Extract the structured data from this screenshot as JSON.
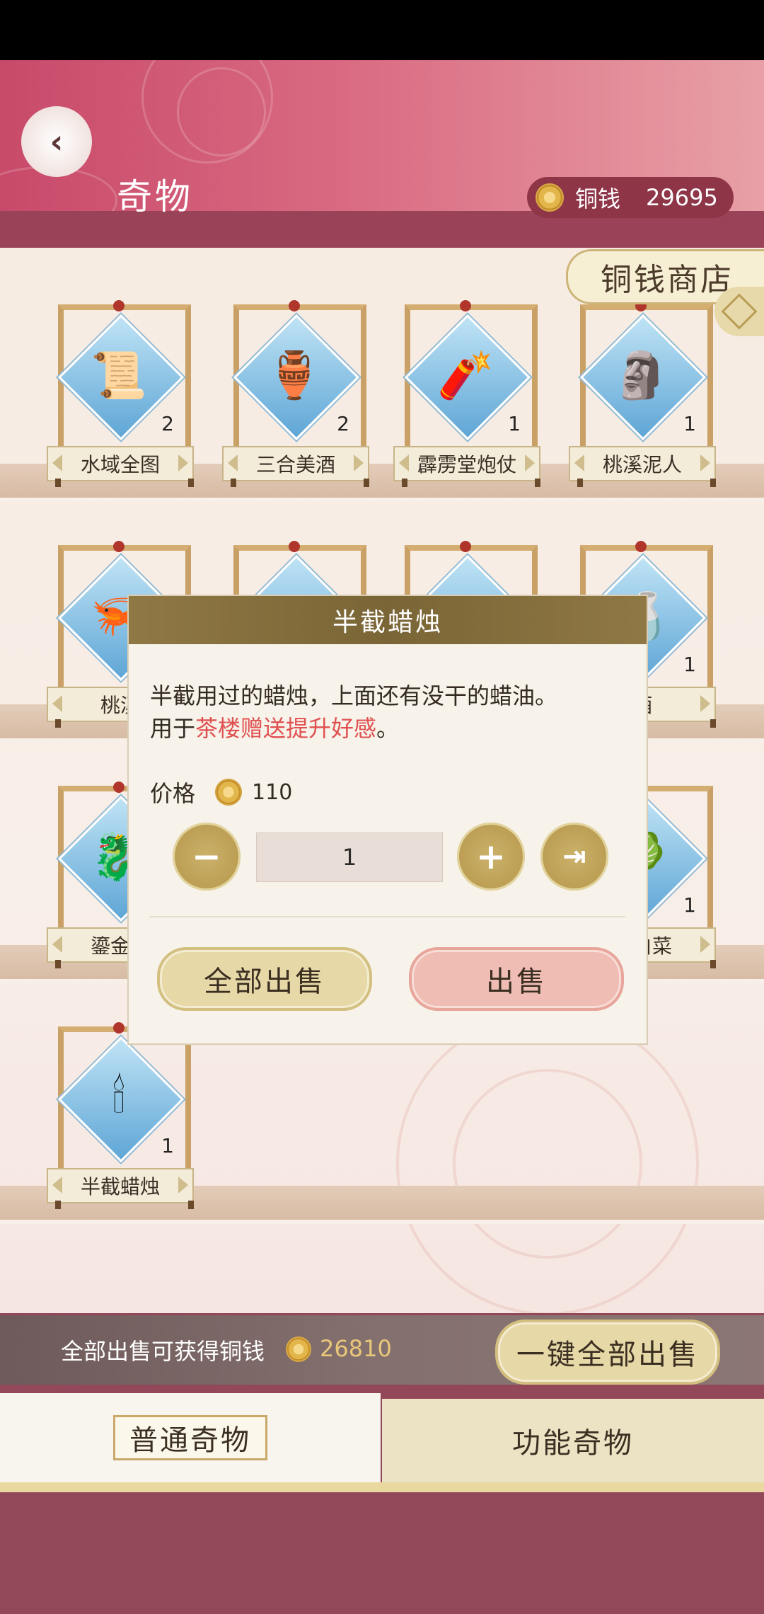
{
  "header": {
    "title": "奇物",
    "currency_label": "铜钱",
    "currency_value": "29695",
    "shop_tag": "铜钱商店"
  },
  "items": [
    {
      "name": "水域全图",
      "count": "2",
      "icon": "map-scroll-icon"
    },
    {
      "name": "三合美酒",
      "count": "2",
      "icon": "wine-jug-icon"
    },
    {
      "name": "霹雳堂炮仗",
      "count": "1",
      "icon": "firecracker-icon"
    },
    {
      "name": "桃溪泥人",
      "count": "1",
      "icon": "clay-figurines-icon"
    },
    {
      "name": "桃溪",
      "count": "",
      "icon": "item-icon"
    },
    {
      "name": "",
      "count": "",
      "icon": "item-icon"
    },
    {
      "name": "",
      "count": "",
      "icon": "item-icon"
    },
    {
      "name": "酒",
      "count": "1",
      "icon": "wine-bottle-icon"
    },
    {
      "name": "鎏金碧",
      "count": "",
      "icon": "jade-hook-icon"
    },
    {
      "name": "大白菜",
      "count": "1",
      "icon": "cabbage-icon"
    },
    {
      "name": "半截蜡烛",
      "count": "1",
      "icon": "candle-icon"
    }
  ],
  "dialog": {
    "title": "半截蜡烛",
    "desc_line1": "半截用过的蜡烛，上面还有没干的蜡油。",
    "desc_prefix": "用于",
    "desc_highlight": "茶楼赠送提升好感",
    "desc_suffix": "。",
    "price_label": "价格",
    "price_value": "110",
    "quantity": "1",
    "minus": "−",
    "plus": "+",
    "max": "⇥",
    "sell_all_label": "全部出售",
    "sell_label": "出售"
  },
  "bottom": {
    "sell_all_text": "全部出售可获得铜钱",
    "sell_all_value": "26810",
    "sell_all_button": "一键全部出售"
  },
  "tabs": {
    "normal": "普通奇物",
    "functional": "功能奇物"
  }
}
